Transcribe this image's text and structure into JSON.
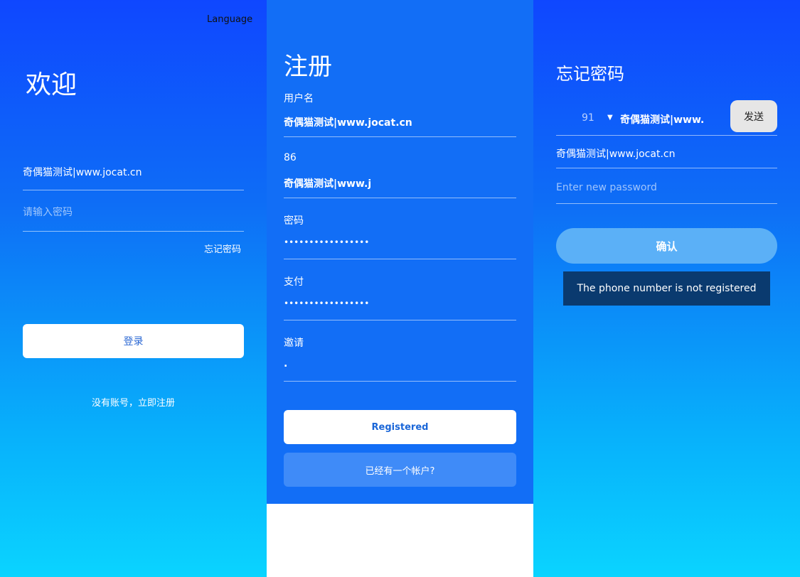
{
  "login": {
    "language_label": "Language",
    "title": "欢迎",
    "username_value": "奇偶猫测试|www.jocat.cn",
    "password_placeholder": "请输入密码",
    "forgot_link": "忘记密码",
    "login_button": "登录",
    "signup_link": "没有账号，立即注册"
  },
  "register": {
    "title": "注册",
    "username_label": "用户名",
    "username_value": "奇偶猫测试|www.jocat.cn",
    "phone_code": "86",
    "phone_value": "奇偶猫测试|www.j",
    "password_label": "密码",
    "password_dots": "•••••••••••••••••",
    "pay_label": "支付",
    "pay_dots": "•••••••••••••••••",
    "invite_label": "邀请",
    "invite_value": ".",
    "register_button": "Registered",
    "have_account_button": "已经有一个帐户?"
  },
  "forgot": {
    "title": "忘记密码",
    "country_code": "91",
    "caret": "▼",
    "phone_value": "奇偶猫测试|www.",
    "send_button": "发送",
    "code_value": "奇偶猫测试|www.jocat.cn",
    "new_password_placeholder": "Enter new password",
    "confirm_button": "确认",
    "toast_message": "The phone number is not registered"
  }
}
